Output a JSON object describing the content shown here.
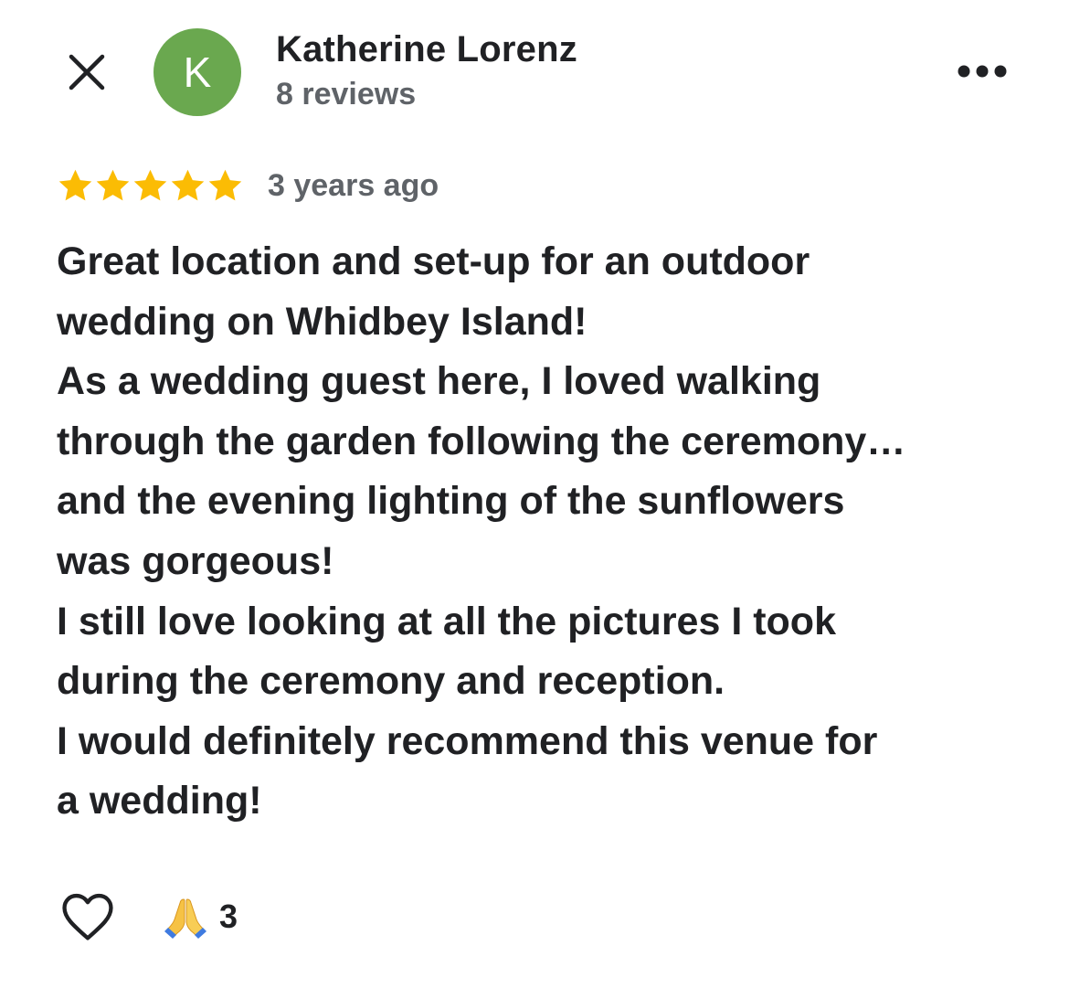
{
  "header": {
    "close_icon": "close-icon",
    "avatar": {
      "letter": "K",
      "color": "#6aa84f"
    },
    "author_name": "Katherine Lorenz",
    "review_count": "8 reviews",
    "more_icon": "more-horizontal-icon"
  },
  "rating": {
    "stars": 5,
    "max_stars": 5,
    "star_color": "#fbbc04",
    "time_ago": "3 years ago"
  },
  "review": {
    "lines": [
      "Great location and set-up for an outdoor",
      "wedding on Whidbey Island!",
      "As a wedding guest here, I loved walking",
      "through the garden following the ceremony…",
      "and the evening lighting of the sunflowers",
      "was gorgeous!",
      "I still love looking at all the pictures I took",
      "during the ceremony and reception.",
      "I would definitely recommend this venue for",
      "a wedding!"
    ]
  },
  "footer": {
    "like_icon": "heart-outline-icon",
    "reaction": {
      "icon": "folded-hands-icon",
      "count": "3"
    }
  }
}
